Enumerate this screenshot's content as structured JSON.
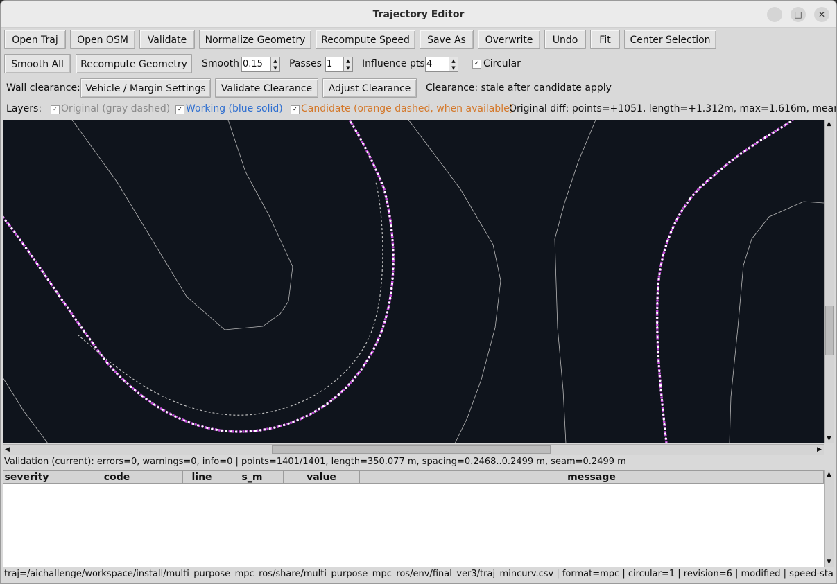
{
  "window": {
    "title": "Trajectory Editor",
    "minimize_glyph": "–",
    "maximize_glyph": "□",
    "close_glyph": "✕"
  },
  "toolbar1": {
    "open_traj": "Open Traj",
    "open_osm": "Open OSM",
    "validate": "Validate",
    "normalize_geometry": "Normalize Geometry",
    "recompute_speed": "Recompute Speed",
    "save_as": "Save As",
    "overwrite": "Overwrite",
    "undo": "Undo",
    "fit": "Fit",
    "center_selection": "Center Selection"
  },
  "toolbar2": {
    "smooth_all": "Smooth All",
    "recompute_geometry": "Recompute Geometry",
    "smooth_label": "Smooth",
    "smooth_value": "0.15",
    "passes_label": "Passes",
    "passes_value": "1",
    "influence_label": "Influence pts",
    "influence_value": "4",
    "circular_label": "Circular",
    "circular_checked": true
  },
  "toolbar3": {
    "wall_clearance_label": "Wall clearance:",
    "vehicle_margin_settings": "Vehicle / Margin Settings",
    "validate_clearance": "Validate Clearance",
    "adjust_clearance": "Adjust Clearance",
    "clearance_status": "Clearance: stale after candidate apply"
  },
  "layers": {
    "label": "Layers:",
    "original": "Original (gray dashed)",
    "working": "Working (blue solid)",
    "candidate": "Candidate (orange dashed, when available)",
    "original_color": "#8a8a8a",
    "working_color": "#2f6fd0",
    "candidate_color": "#d4782a",
    "diff": "Original diff: points=+1051, length=+1.312m, max=1.616m, mean=1."
  },
  "canvas": {
    "background": "#0f141c",
    "wall_color": "#b8b8b8",
    "trajectory_color": "#c14ad8",
    "point_color": "#ffffff",
    "original_color": "#bdbdbd"
  },
  "validation": {
    "text": "Validation (current): errors=0, warnings=0, info=0 | points=1401/1401, length=350.077 m, spacing=0.2468..0.2499 m, seam=0.2499 m"
  },
  "table": {
    "columns": [
      "severity",
      "code",
      "line",
      "s_m",
      "value",
      "message"
    ],
    "rows": []
  },
  "statusbar": {
    "text": "traj=/aichallenge/workspace/install/multi_purpose_mpc_ros/share/multi_purpose_mpc_ros/env/final_ver3/traj_mincurv.csv | format=mpc | circular=1 | revision=6 | modified | speed-sta"
  }
}
